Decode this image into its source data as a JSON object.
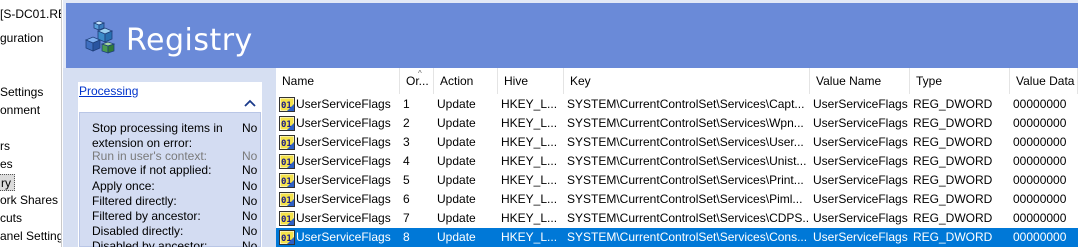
{
  "tree": {
    "items": [
      {
        "label": "[S-DC01.RE",
        "selected": false
      },
      {
        "label": "guration",
        "selected": false
      },
      {
        "label": "Settings",
        "selected": false
      },
      {
        "label": "onment",
        "selected": false
      },
      {
        "label": "rs",
        "selected": false
      },
      {
        "label": "es",
        "selected": false
      },
      {
        "label": "ry",
        "selected": true
      },
      {
        "label": "ork Shares",
        "selected": false
      },
      {
        "label": "cuts",
        "selected": false
      },
      {
        "label": "anel Setting",
        "selected": false
      }
    ]
  },
  "header": {
    "title": "Registry",
    "icon": "registry-cubes-icon"
  },
  "properties": {
    "section_link": "Processing",
    "collapse_icon": "chevron-up-icon",
    "rows": [
      {
        "label": "Stop processing items in extension on error:",
        "value": "No",
        "dim": false
      },
      {
        "label": "Run in user's context:",
        "value": "No",
        "dim": true
      },
      {
        "label": "Remove if not applied:",
        "value": "No",
        "dim": false
      },
      {
        "label": "Apply once:",
        "value": "No",
        "dim": false
      },
      {
        "label": "Filtered directly:",
        "value": "No",
        "dim": false
      },
      {
        "label": "Filtered by ancestor:",
        "value": "No",
        "dim": false
      },
      {
        "label": "Disabled directly:",
        "value": "No",
        "dim": false
      },
      {
        "label": "Disabled by ancestor:",
        "value": "No",
        "dim": false
      }
    ]
  },
  "table": {
    "sort_glyph": "^",
    "columns": [
      "Name",
      "Or...",
      "Action",
      "Hive",
      "Key",
      "Value Name",
      "Type",
      "Value Data"
    ],
    "row_icon": "registry-value-icon",
    "rows": [
      [
        "UserServiceFlags",
        "1",
        "Update",
        "HKEY_L...",
        "SYSTEM\\CurrentControlSet\\Services\\Capt...",
        "UserServiceFlags",
        "REG_DWORD",
        "00000000"
      ],
      [
        "UserServiceFlags",
        "2",
        "Update",
        "HKEY_L...",
        "SYSTEM\\CurrentControlSet\\Services\\Wpn...",
        "UserServiceFlags",
        "REG_DWORD",
        "00000000"
      ],
      [
        "UserServiceFlags",
        "3",
        "Update",
        "HKEY_L...",
        "SYSTEM\\CurrentControlSet\\Services\\User...",
        "UserServiceFlags",
        "REG_DWORD",
        "00000000"
      ],
      [
        "UserServiceFlags",
        "4",
        "Update",
        "HKEY_L...",
        "SYSTEM\\CurrentControlSet\\Services\\Unist...",
        "UserServiceFlags",
        "REG_DWORD",
        "00000000"
      ],
      [
        "UserServiceFlags",
        "5",
        "Update",
        "HKEY_L...",
        "SYSTEM\\CurrentControlSet\\Services\\Print...",
        "UserServiceFlags",
        "REG_DWORD",
        "00000000"
      ],
      [
        "UserServiceFlags",
        "6",
        "Update",
        "HKEY_L...",
        "SYSTEM\\CurrentControlSet\\Services\\Piml...",
        "UserServiceFlags",
        "REG_DWORD",
        "00000000"
      ],
      [
        "UserServiceFlags",
        "7",
        "Update",
        "HKEY_L...",
        "SYSTEM\\CurrentControlSet\\Services\\CDPS...",
        "UserServiceFlags",
        "REG_DWORD",
        "00000000"
      ],
      [
        "UserServiceFlags",
        "8",
        "Update",
        "HKEY_L...",
        "SYSTEM\\CurrentControlSet\\Services\\Cons...",
        "UserServiceFlags",
        "REG_DWORD",
        "00000000"
      ]
    ],
    "selected_row": 7
  },
  "colors": {
    "header_bg": "#6a8ad8",
    "panel_bg": "#d6dff2",
    "selection": "#0078d7",
    "link": "#0033cc"
  }
}
